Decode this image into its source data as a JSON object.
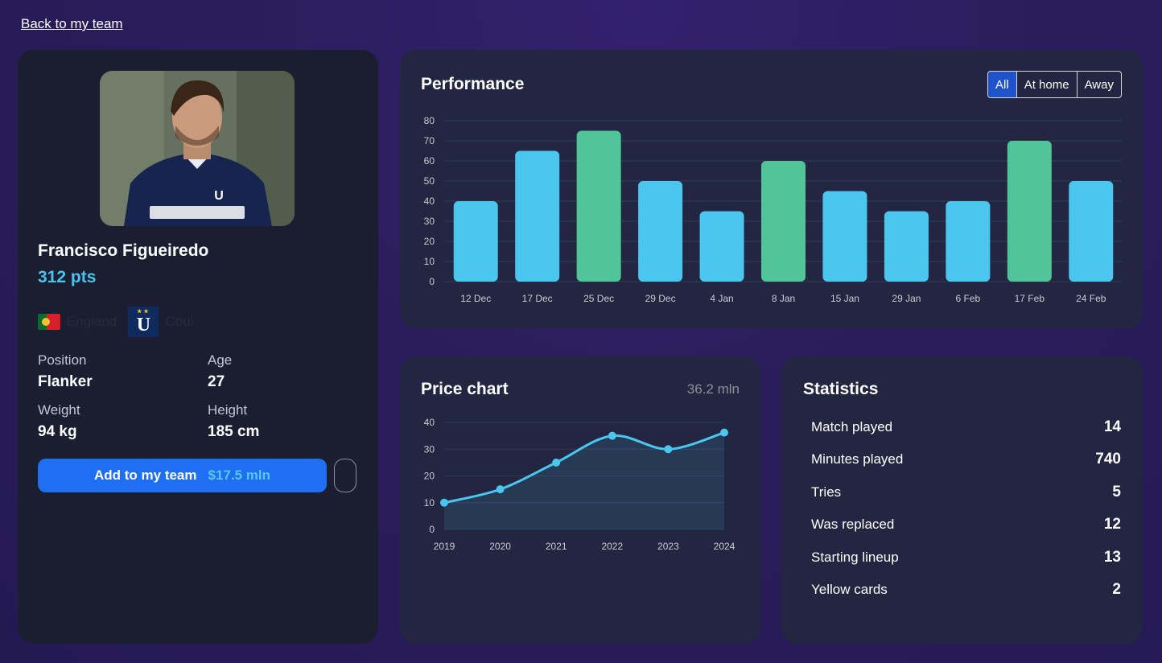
{
  "nav": {
    "back_label": "Back to my team"
  },
  "player": {
    "name": "Francisco Figueiredo",
    "points": "312 pts",
    "country": "England",
    "club": "Coul",
    "club_badge_letter": "U",
    "attributes": [
      {
        "label": "Position",
        "value": "Flanker"
      },
      {
        "label": "Age",
        "value": "27"
      },
      {
        "label": "Weight",
        "value": "94 kg"
      },
      {
        "label": "Height",
        "value": "185 cm"
      }
    ],
    "add_button_label": "Add to my team",
    "add_button_price": "$17.5 mln"
  },
  "performance": {
    "title": "Performance",
    "filters": [
      {
        "label": "All",
        "active": true
      },
      {
        "label": "At home",
        "active": false
      },
      {
        "label": "Away",
        "active": false
      }
    ]
  },
  "price": {
    "title": "Price chart",
    "current_value": "36.2 mln"
  },
  "statistics": {
    "title": "Statistics",
    "rows": [
      {
        "label": "Match played",
        "value": "14"
      },
      {
        "label": "Minutes played",
        "value": "740"
      },
      {
        "label": "Tries",
        "value": "5"
      },
      {
        "label": "Was replaced",
        "value": "12"
      },
      {
        "label": "Starting lineup",
        "value": "13"
      },
      {
        "label": "Yellow cards",
        "value": "2"
      }
    ]
  },
  "colors": {
    "bar_default": "#4ac6ef",
    "bar_highlight": "#52c49a",
    "line": "#4ac6ef",
    "accent_button": "#1f6ff2"
  },
  "chart_data": [
    {
      "type": "bar",
      "categories": [
        "12 Dec",
        "17 Dec",
        "25 Dec",
        "29 Dec",
        "4 Jan",
        "8 Jan",
        "15 Jan",
        "29 Jan",
        "6 Feb",
        "17 Feb",
        "24 Feb"
      ],
      "values": [
        40,
        65,
        75,
        50,
        35,
        60,
        45,
        35,
        40,
        70,
        50
      ],
      "highlighted": [
        false,
        false,
        true,
        false,
        false,
        true,
        false,
        false,
        false,
        true,
        false
      ],
      "ylim": [
        0,
        80
      ],
      "yticks": [
        0,
        10,
        20,
        30,
        40,
        50,
        60,
        70,
        80
      ],
      "grid": true
    },
    {
      "type": "area",
      "x": [
        "2019",
        "2020",
        "2021",
        "2022",
        "2023",
        "2024"
      ],
      "values": [
        10,
        15,
        25,
        35,
        30,
        36.2
      ],
      "ylim": [
        0,
        40
      ],
      "yticks": [
        0,
        10,
        20,
        30,
        40
      ],
      "grid": true
    }
  ]
}
